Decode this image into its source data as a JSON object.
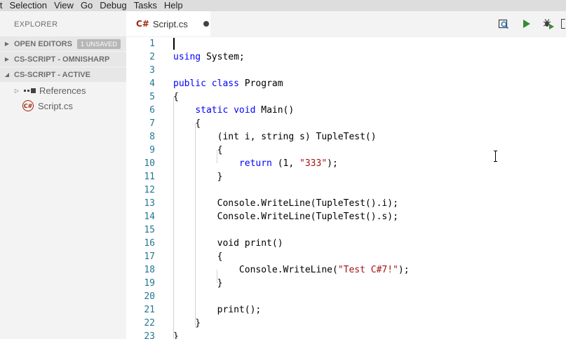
{
  "menubar": {
    "items": [
      "it",
      "Selection",
      "View",
      "Go",
      "Debug",
      "Tasks",
      "Help"
    ]
  },
  "sidebar": {
    "title": "EXPLORER",
    "sections": [
      {
        "label": "OPEN EDITORS",
        "badge": "1 UNSAVED",
        "expanded": false
      },
      {
        "label": "CS-SCRIPT - OMNISHARP",
        "expanded": false
      },
      {
        "label": "CS-SCRIPT - ACTIVE",
        "expanded": true
      }
    ],
    "tree": [
      {
        "label": "References",
        "icon": "references-icon"
      },
      {
        "label": "Script.cs",
        "icon": "csharp-file-icon"
      }
    ]
  },
  "tabs": [
    {
      "label": "Script.cs",
      "icon_text": "C#",
      "dirty": true
    }
  ],
  "actions": [
    {
      "name": "search-in-file-icon"
    },
    {
      "name": "run-icon"
    },
    {
      "name": "debug-icon"
    }
  ],
  "colors": {
    "keyword": "#0000ff",
    "string": "#a31515",
    "line_number": "#237893",
    "run_green": "#388a34"
  },
  "editor": {
    "lines": [
      {
        "n": "1",
        "tokens": []
      },
      {
        "n": "2",
        "tokens": [
          {
            "t": "kw",
            "v": "using"
          },
          {
            "t": "tx",
            "v": " System;"
          }
        ]
      },
      {
        "n": "3",
        "tokens": []
      },
      {
        "n": "4",
        "tokens": [
          {
            "t": "kw",
            "v": "public"
          },
          {
            "t": "tx",
            "v": " "
          },
          {
            "t": "kw",
            "v": "class"
          },
          {
            "t": "tx",
            "v": " Program"
          }
        ]
      },
      {
        "n": "5",
        "tokens": [
          {
            "t": "tx",
            "v": "{"
          }
        ]
      },
      {
        "n": "6",
        "tokens": [
          {
            "t": "tx",
            "v": "    "
          },
          {
            "t": "kw",
            "v": "static"
          },
          {
            "t": "tx",
            "v": " "
          },
          {
            "t": "kw",
            "v": "void"
          },
          {
            "t": "tx",
            "v": " Main()"
          }
        ]
      },
      {
        "n": "7",
        "tokens": [
          {
            "t": "tx",
            "v": "    {"
          }
        ]
      },
      {
        "n": "8",
        "tokens": [
          {
            "t": "tx",
            "v": "        (int i, string s) TupleTest()"
          }
        ]
      },
      {
        "n": "9",
        "tokens": [
          {
            "t": "tx",
            "v": "        {"
          }
        ]
      },
      {
        "n": "10",
        "tokens": [
          {
            "t": "tx",
            "v": "            "
          },
          {
            "t": "kw",
            "v": "return"
          },
          {
            "t": "tx",
            "v": " (1, "
          },
          {
            "t": "str",
            "v": "\"333\""
          },
          {
            "t": "tx",
            "v": ");"
          }
        ]
      },
      {
        "n": "11",
        "tokens": [
          {
            "t": "tx",
            "v": "        }"
          }
        ]
      },
      {
        "n": "12",
        "tokens": []
      },
      {
        "n": "13",
        "tokens": [
          {
            "t": "tx",
            "v": "        Console.WriteLine(TupleTest().i);"
          }
        ]
      },
      {
        "n": "14",
        "tokens": [
          {
            "t": "tx",
            "v": "        Console.WriteLine(TupleTest().s);"
          }
        ]
      },
      {
        "n": "15",
        "tokens": []
      },
      {
        "n": "16",
        "tokens": [
          {
            "t": "tx",
            "v": "        void print()"
          }
        ]
      },
      {
        "n": "17",
        "tokens": [
          {
            "t": "tx",
            "v": "        {"
          }
        ]
      },
      {
        "n": "18",
        "tokens": [
          {
            "t": "tx",
            "v": "            Console.WriteLine("
          },
          {
            "t": "str",
            "v": "\"Test C#7!\""
          },
          {
            "t": "tx",
            "v": ");"
          }
        ]
      },
      {
        "n": "19",
        "tokens": [
          {
            "t": "tx",
            "v": "        }"
          }
        ]
      },
      {
        "n": "20",
        "tokens": []
      },
      {
        "n": "21",
        "tokens": [
          {
            "t": "tx",
            "v": "        print();"
          }
        ]
      },
      {
        "n": "22",
        "tokens": [
          {
            "t": "tx",
            "v": "    }"
          }
        ]
      },
      {
        "n": "23",
        "tokens": [
          {
            "t": "tx",
            "v": "}"
          }
        ]
      }
    ]
  }
}
